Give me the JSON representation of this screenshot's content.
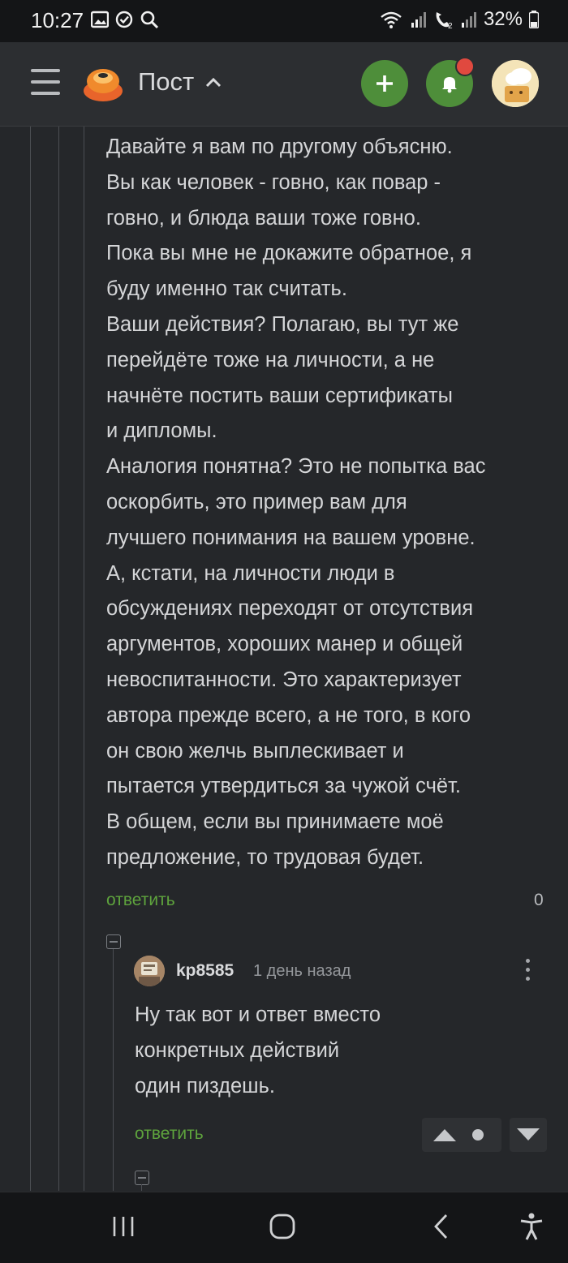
{
  "status_bar": {
    "time": "10:27",
    "battery": "32%"
  },
  "header": {
    "title": "Пост"
  },
  "comment": {
    "lines": [
      "Давайте я вам по другому объясню.",
      "Вы как человек - говно, как повар -",
      "говно, и блюда ваши тоже говно.",
      "Пока вы мне не докажите обратное, я",
      "буду именно так считать.",
      "Ваши действия? Полагаю, вы тут же",
      "перейдёте тоже на личности, а не",
      "начнёте постить ваши сертификаты",
      "и дипломы.",
      "Аналогия понятна? Это не попытка вас",
      "оскорбить, это пример вам для",
      "лучшего понимания на вашем уровне.",
      "А, кстати, на личности люди в",
      "обсуждениях переходят от отсутствия",
      "аргументов, хороших манер и общей",
      "невоспитанности. Это характеризует",
      "автора прежде всего, а не того, в кого",
      "он свою желчь выплескивает и",
      "пытается утвердиться за чужой счёт.",
      "В общем, если вы принимаете моё",
      "предложение, то трудовая будет."
    ],
    "reply_label": "ответить",
    "score": "0"
  },
  "reply": {
    "username": "kp8585",
    "time_ago": "1 день назад",
    "lines": [
      "Ну так вот и ответ вместо",
      "конкретных действий",
      "один пиздешь."
    ],
    "reply_label": "ответить"
  },
  "colors": {
    "background": "#25272a",
    "accent_green": "#4e8e3a",
    "link_green": "#5ea33d",
    "notification": "#e0493f"
  }
}
